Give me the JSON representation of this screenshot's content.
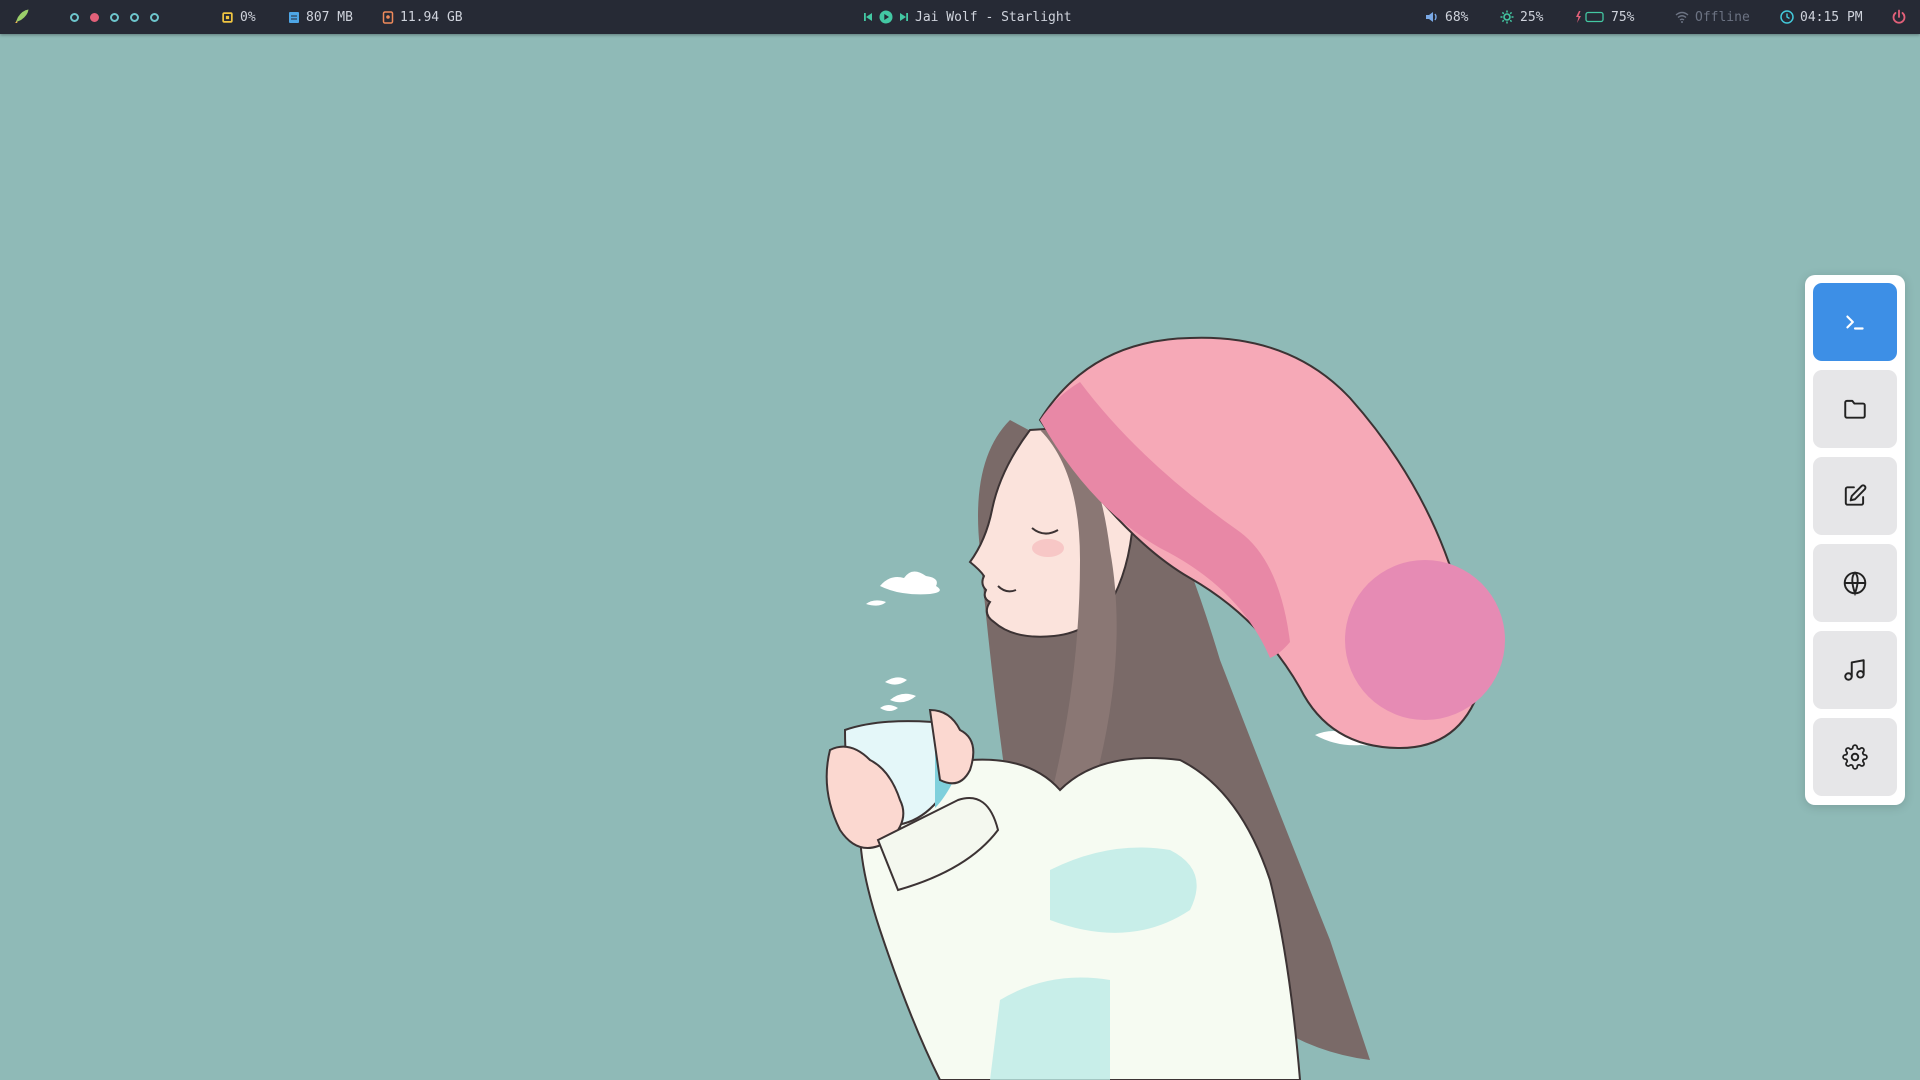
{
  "topbar": {
    "launcher_icon": "rocket-icon",
    "workspaces": [
      {
        "active": false
      },
      {
        "active": true
      },
      {
        "active": false
      },
      {
        "active": false
      },
      {
        "active": false
      }
    ],
    "cpu": {
      "icon": "cpu-icon",
      "value": "0%"
    },
    "memory": {
      "icon": "memory-icon",
      "value": "807 MB"
    },
    "disk": {
      "icon": "disk-icon",
      "value": "11.94 GB"
    },
    "media": {
      "track": "Jai Wolf - Starlight",
      "prev_icon": "skip-back-icon",
      "play_icon": "play-icon",
      "next_icon": "skip-forward-icon"
    },
    "volume": {
      "icon": "volume-icon",
      "value": "68%"
    },
    "brightness": {
      "icon": "brightness-icon",
      "value": "25%"
    },
    "battery": {
      "icon": "battery-charging-icon",
      "value": "75%",
      "level": 0.75
    },
    "network": {
      "icon": "wifi-icon",
      "value": "Offline"
    },
    "clock": {
      "icon": "clock-icon",
      "value": "04:15 PM"
    },
    "power_icon": "power-icon"
  },
  "dock": {
    "items": [
      {
        "name": "terminal",
        "icon": "terminal-icon",
        "active": true
      },
      {
        "name": "files",
        "icon": "folder-icon",
        "active": false
      },
      {
        "name": "editor",
        "icon": "edit-icon",
        "active": false
      },
      {
        "name": "browser",
        "icon": "globe-icon",
        "active": false
      },
      {
        "name": "music",
        "icon": "music-icon",
        "active": false
      },
      {
        "name": "settings",
        "icon": "gear-icon",
        "active": false
      }
    ]
  },
  "colors": {
    "background": "#8fbab7",
    "bar": "#262a35",
    "accent": "#3d8fe6",
    "workspace_active": "#e26079",
    "workspace": "#6dc5cc"
  }
}
